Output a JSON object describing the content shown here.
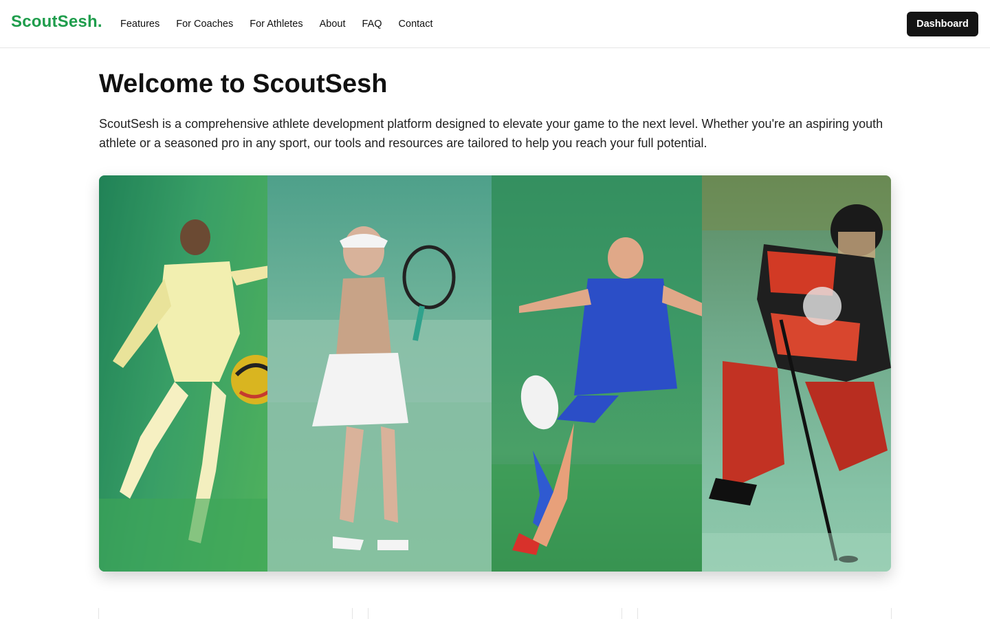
{
  "header": {
    "logo": "ScoutSesh.",
    "nav": [
      "Features",
      "For Coaches",
      "For Athletes",
      "About",
      "FAQ",
      "Contact"
    ],
    "dashboard_label": "Dashboard"
  },
  "main": {
    "title": "Welcome to ScoutSesh",
    "intro": "ScoutSesh is a comprehensive athlete development platform designed to elevate your game to the next level. Whether you're an aspiring youth athlete or a seasoned pro in any sport, our tools and resources are tailored to help you reach your full potential."
  },
  "colors": {
    "brand_green": "#1f9d4c",
    "button_dark": "#141414"
  }
}
